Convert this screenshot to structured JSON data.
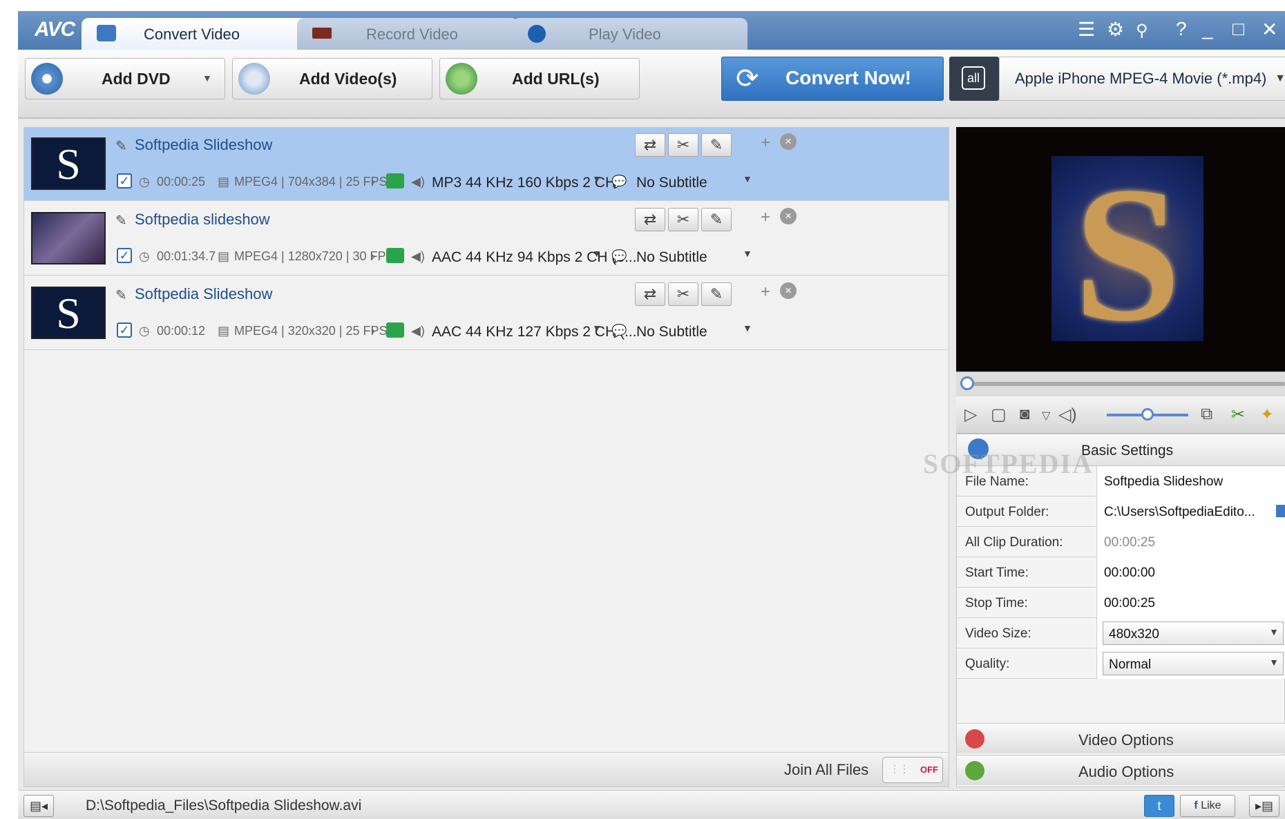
{
  "app": {
    "logo": "AVC"
  },
  "tabs": [
    {
      "label": "Convert Video",
      "icon": "convert-icon"
    },
    {
      "label": "Record Video",
      "icon": "record-icon"
    },
    {
      "label": "Play Video",
      "icon": "play-icon"
    }
  ],
  "window_controls": [
    "menu-icon",
    "gear-icon",
    "search-icon",
    "help-icon",
    "minimize-icon",
    "maximize-icon",
    "close-icon"
  ],
  "toolbar": {
    "add_dvd": "Add DVD",
    "add_videos": "Add Video(s)",
    "add_urls": "Add URL(s)",
    "convert_now": "Convert Now!",
    "profile_icon": "all",
    "profile": "Apple iPhone MPEG-4 Movie (*.mp4)"
  },
  "files": [
    {
      "name": "Softpedia Slideshow",
      "duration": "00:00:25",
      "video": "MPEG4 | 704x384 | 25 FPS",
      "audio": "MP3 44 KHz 160 Kbps 2 CH",
      "subtitle": "No Subtitle",
      "selected": true
    },
    {
      "name": "Softpedia slideshow",
      "duration": "00:01:34.7",
      "video": "MPEG4 | 1280x720 | 30 FPS",
      "audio": "AAC 44 KHz 94 Kbps 2 CH (e...",
      "subtitle": "No Subtitle",
      "selected": false
    },
    {
      "name": "Softpedia Slideshow",
      "duration": "00:00:12",
      "video": "MPEG4 | 320x320 | 25 FPS",
      "audio": "AAC 44 KHz 127 Kbps 2 CH (...",
      "subtitle": "No Subtitle",
      "selected": false
    }
  ],
  "thumb_letter": "S",
  "join": {
    "label": "Join All Files",
    "state": "OFF"
  },
  "settings": {
    "title": "Basic Settings",
    "rows": [
      {
        "key": "File Name:",
        "value": "Softpedia Slideshow"
      },
      {
        "key": "Output Folder:",
        "value": "C:\\Users\\SoftpediaEdito..."
      },
      {
        "key": "All Clip Duration:",
        "value": "00:00:25"
      },
      {
        "key": "Start Time:",
        "value": "00:00:00"
      },
      {
        "key": "Stop Time:",
        "value": "00:00:25"
      },
      {
        "key": "Video Size:",
        "value": "480x320"
      },
      {
        "key": "Quality:",
        "value": "Normal"
      }
    ],
    "video_options": "Video Options",
    "audio_options": "Audio Options"
  },
  "watermark": "SOFTPEDIA",
  "status": {
    "path": "D:\\Softpedia_Files\\Softpedia Slideshow.avi",
    "like": "Like"
  },
  "colors": {
    "accent": "#2f72c0",
    "selected_row": "#a9c8f0",
    "titlebar": "#4e7bb2"
  }
}
